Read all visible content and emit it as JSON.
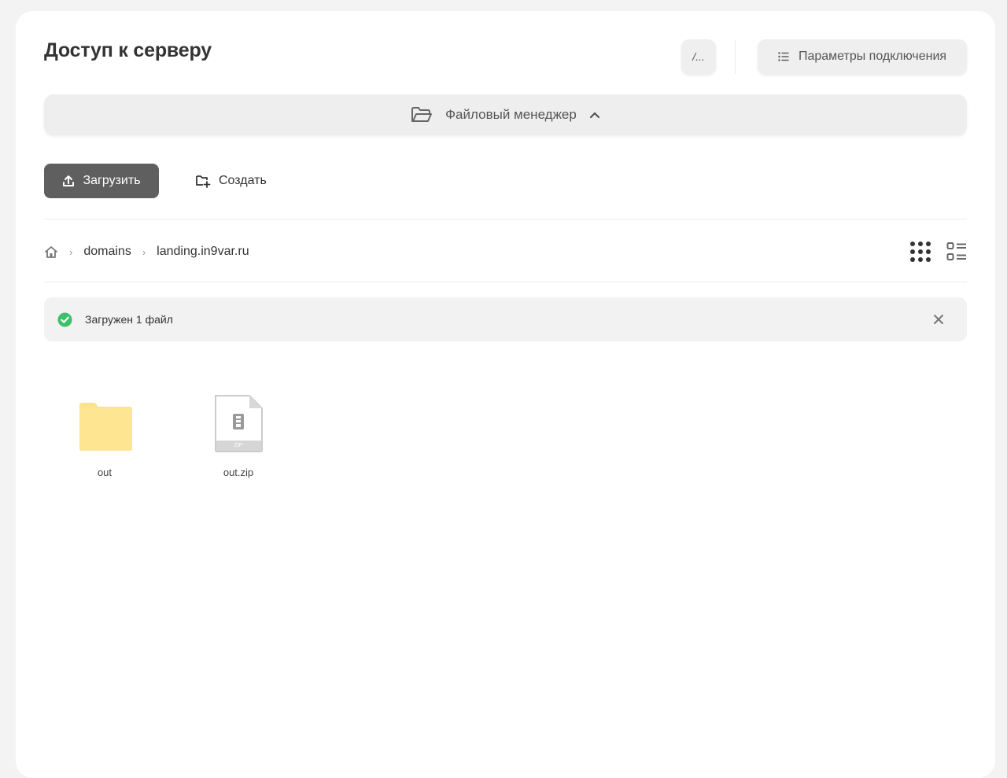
{
  "page": {
    "title": "Доступ к серверу"
  },
  "header": {
    "console_label": "/...",
    "params_label": "Параметры подключения"
  },
  "file_manager": {
    "label": "Файловый менеджер"
  },
  "toolbar": {
    "upload_label": "Загрузить",
    "create_label": "Создать"
  },
  "breadcrumb": {
    "items": [
      "domains",
      "landing.in9var.ru"
    ]
  },
  "notice": {
    "text": "Загружен 1 файл",
    "status_color": "#3cc06a"
  },
  "files": [
    {
      "name": "out",
      "type": "folder",
      "icon": "folder-icon",
      "color": "#fde28b"
    },
    {
      "name": "out.zip",
      "type": "zip",
      "icon": "zip-file-icon",
      "badge": "ZIP"
    }
  ],
  "colors": {
    "upload_button_bg": "#5f5f5f",
    "card_bg": "#ffffff",
    "page_bg": "#f3f3f3"
  }
}
